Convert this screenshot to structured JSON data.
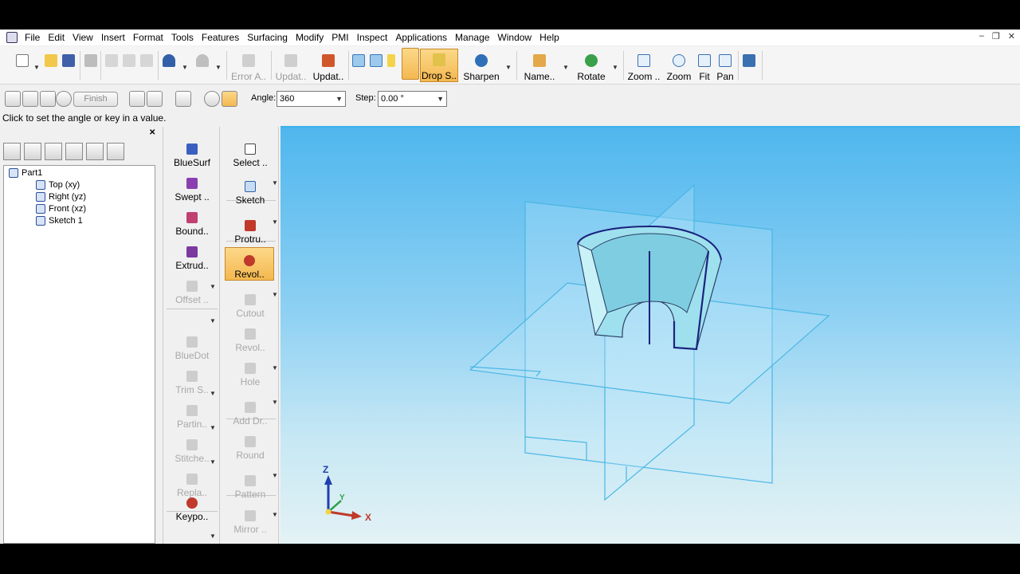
{
  "menu": [
    "File",
    "Edit",
    "View",
    "Insert",
    "Format",
    "Tools",
    "Features",
    "Surfacing",
    "Modify",
    "PMI",
    "Inspect",
    "Applications",
    "Manage",
    "Window",
    "Help"
  ],
  "window_controls": {
    "minimize": "–",
    "restore": "❐",
    "close": "✕"
  },
  "ribbon": {
    "error_assistant": "Error A..",
    "update": "Updat..",
    "update_active": "Updat..",
    "drop_shadow": "Drop S..",
    "sharpen": "Sharpen",
    "named_views": "Name..",
    "rotate": "Rotate",
    "zoom_area": "Zoom ..",
    "zoom": "Zoom",
    "fit": "Fit",
    "pan": "Pan"
  },
  "command_bar": {
    "finish": "Finish",
    "angle_label": "Angle:",
    "angle_value": "360",
    "step_label": "Step:",
    "step_value": "0.00 °"
  },
  "status": "Click to set the angle or key in a value.",
  "pathfinder": {
    "tree": [
      {
        "label": "Part1"
      },
      {
        "label": "Top (xy)"
      },
      {
        "label": "Right (yz)"
      },
      {
        "label": "Front (xz)"
      },
      {
        "label": "Sketch 1"
      }
    ]
  },
  "features": {
    "left": [
      {
        "label": "BlueSurf",
        "enabled": true
      },
      {
        "label": "Swept ..",
        "enabled": true
      },
      {
        "label": "Bound..",
        "enabled": true
      },
      {
        "label": "Extrud..",
        "enabled": true
      },
      {
        "label": "Offset ..",
        "enabled": false
      },
      {
        "label": "BlueDot",
        "enabled": false
      },
      {
        "label": "Trim S..",
        "enabled": false
      },
      {
        "label": "Partin..",
        "enabled": false
      },
      {
        "label": "Stitche..",
        "enabled": false
      },
      {
        "label": "Repla..",
        "enabled": false
      },
      {
        "label": "Keypo..",
        "enabled": true
      }
    ],
    "right": [
      {
        "label": "Select ..",
        "enabled": true
      },
      {
        "label": "Sketch",
        "enabled": true
      },
      {
        "label": "Protru..",
        "enabled": true
      },
      {
        "label": "Revol..",
        "enabled": true,
        "active": true
      },
      {
        "label": "Cutout",
        "enabled": false
      },
      {
        "label": "Revol..",
        "enabled": false
      },
      {
        "label": "Hole",
        "enabled": false
      },
      {
        "label": "Add Dr..",
        "enabled": false
      },
      {
        "label": "Round",
        "enabled": false
      },
      {
        "label": "Pattern",
        "enabled": false
      },
      {
        "label": "Mirror ..",
        "enabled": false
      }
    ]
  },
  "triad": {
    "x": "X",
    "y": "Y",
    "z": "Z"
  },
  "colors": {
    "accent": "#f4b850",
    "viewport_top": "#4fb7ee",
    "plane": "#4ab6e4",
    "part": "#9fe0ee",
    "edge": "#1a237e"
  }
}
